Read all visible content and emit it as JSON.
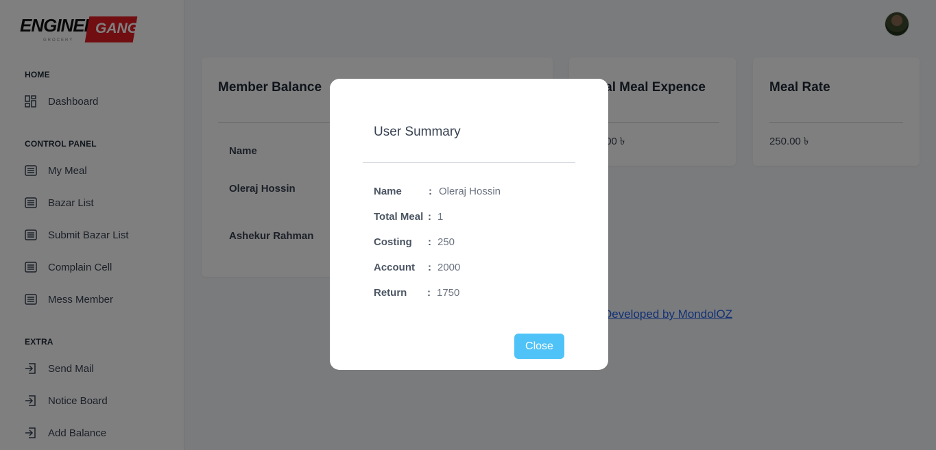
{
  "brand": {
    "word1": "ENGINEER",
    "word2": "GANG",
    "tagline": "GROCERY"
  },
  "sidebar": {
    "sections": [
      {
        "title": "HOME",
        "items": [
          {
            "label": "Dashboard",
            "icon": "dashboard-icon"
          }
        ]
      },
      {
        "title": "CONTROL PANEL",
        "items": [
          {
            "label": "My Meal",
            "icon": "list-icon"
          },
          {
            "label": "Bazar List",
            "icon": "list-icon"
          },
          {
            "label": "Submit Bazar List",
            "icon": "list-icon"
          },
          {
            "label": "Complain Cell",
            "icon": "list-icon"
          },
          {
            "label": "Mess Member",
            "icon": "list-icon"
          }
        ]
      },
      {
        "title": "EXTRA",
        "items": [
          {
            "label": "Send Mail",
            "icon": "login-icon"
          },
          {
            "label": "Notice Board",
            "icon": "login-icon"
          },
          {
            "label": "Add Balance",
            "icon": "login-icon"
          }
        ]
      }
    ]
  },
  "cards": {
    "member_balance": {
      "title": "Member Balance",
      "column": "Name",
      "rows": [
        "Oleraj Hossin",
        "Ashekur Rahman"
      ]
    },
    "meal_expense": {
      "title": "Total Meal Expence",
      "value": "250.00 ৳"
    },
    "meal_rate": {
      "title": "Meal Rate",
      "value": "250.00 ৳"
    }
  },
  "footer": {
    "link_text": "Developed by MondolOZ"
  },
  "modal": {
    "title": "User Summary",
    "rows": [
      {
        "key": "Name",
        "value": "Oleraj Hossin"
      },
      {
        "key": "Total Meal",
        "value": "1"
      },
      {
        "key": "Costing",
        "value": "250"
      },
      {
        "key": "Account",
        "value": "2000"
      },
      {
        "key": "Return",
        "value": "1750"
      }
    ],
    "separator": ":",
    "close_label": "Close"
  },
  "colors": {
    "accent": "#4fc3f7",
    "brand_red": "#e11d24",
    "overlay": "rgba(0,0,0,0.5)"
  }
}
